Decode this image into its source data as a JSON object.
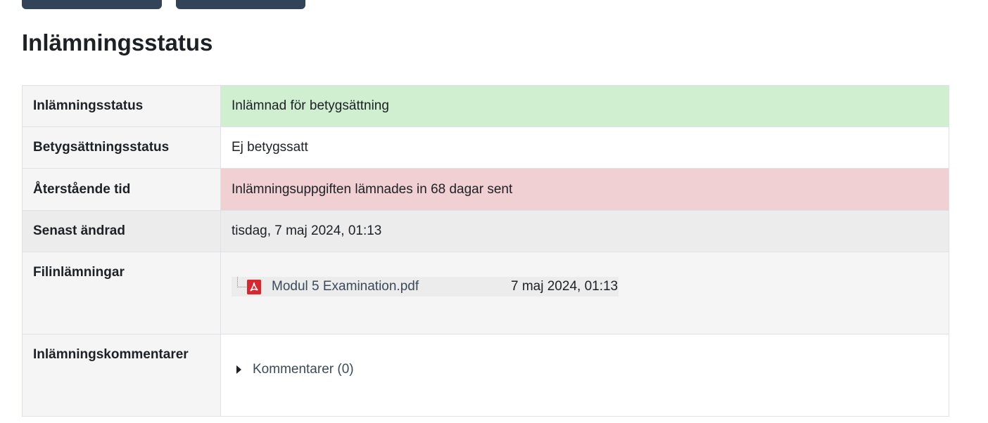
{
  "heading": "Inlämningsstatus",
  "rows": [
    {
      "label": "Inlämningsstatus",
      "value": "Inlämnad för betygsättning"
    },
    {
      "label": "Betygsättningsstatus",
      "value": "Ej betygssatt"
    },
    {
      "label": "Återstående tid",
      "value": "Inlämningsuppgiften lämnades in 68 dagar sent"
    },
    {
      "label": "Senast ändrad",
      "value": "tisdag, 7 maj 2024, 01:13"
    },
    {
      "label": "Filinlämningar"
    },
    {
      "label": "Inlämningskommentarer"
    }
  ],
  "file": {
    "name": "Modul 5 Examination.pdf",
    "date": "7 maj 2024, 01:13",
    "icon": "pdf-icon"
  },
  "comments": {
    "label": "Kommentarer (0)",
    "icon": "caret-right-icon"
  },
  "colors": {
    "submitted": "#cfefd0",
    "overdue": "#f0d0d2",
    "button": "#344458"
  }
}
